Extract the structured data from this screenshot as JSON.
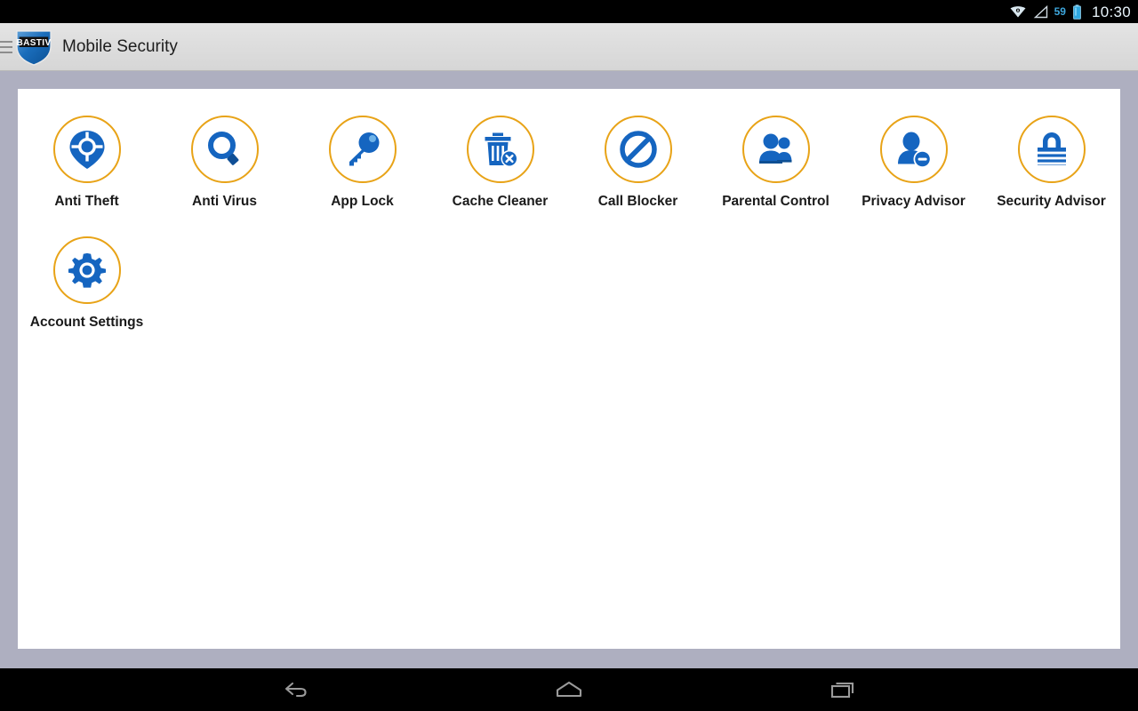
{
  "statusbar": {
    "wifi_icon": "wifi-icon",
    "signal_icon": "signal-triangle-icon",
    "battery_percent": "59",
    "battery_icon": "battery-icon",
    "clock": "10:30"
  },
  "appbar": {
    "menu_icon": "hamburger-menu-icon",
    "logo_icon": "bastiv-shield-logo",
    "logo_text": "BASTIV",
    "title": "Mobile Security"
  },
  "theme": {
    "circle_border": "#e8a317",
    "icon_blue": "#1565c0",
    "icon_blue_light": "#2f86d6",
    "label_color": "#1a1a1a",
    "page_background": "#aeafc0",
    "card_background": "#ffffff",
    "appbar_background": "#dcdcdc",
    "status_accent": "#3ea7dd"
  },
  "main": {
    "tiles": [
      {
        "label": "Anti Theft",
        "icon": "location-pin-crosshair-icon"
      },
      {
        "label": "Anti Virus",
        "icon": "magnifier-icon"
      },
      {
        "label": "App Lock",
        "icon": "key-icon"
      },
      {
        "label": "Cache Cleaner",
        "icon": "trash-can-delete-icon"
      },
      {
        "label": "Call Blocker",
        "icon": "no-entry-icon"
      },
      {
        "label": "Parental Control",
        "icon": "two-people-icon"
      },
      {
        "label": "Privacy Advisor",
        "icon": "person-minus-icon"
      },
      {
        "label": "Security Advisor",
        "icon": "padlock-icon"
      },
      {
        "label": "Account Settings",
        "icon": "gear-icon"
      }
    ]
  },
  "navbar": {
    "back_label": "Back",
    "home_label": "Home",
    "recents_label": "Recent apps"
  }
}
